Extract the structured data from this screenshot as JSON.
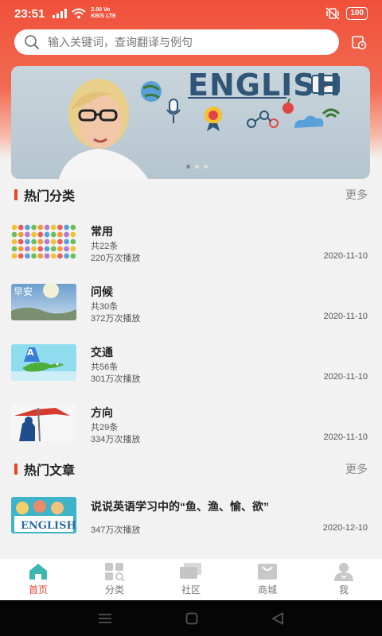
{
  "status_bar": {
    "time": "23:51",
    "net_speed_top": "2.00",
    "net_speed_unit": "KB/S",
    "net_type": "Vo",
    "net_lte": "LTE",
    "battery": "100"
  },
  "search": {
    "placeholder": "输入关键词，查询翻译与例句"
  },
  "banner": {
    "text": "ENGLISH",
    "pages": 3,
    "active_page": 0
  },
  "hot_categories": {
    "title": "热门分类",
    "more": "更多",
    "items": [
      {
        "title": "常用",
        "count": "共22条",
        "plays": "220万次播放",
        "date": "2020-11-10"
      },
      {
        "title": "问候",
        "count": "共30条",
        "plays": "372万次播放",
        "date": "2020-11-10"
      },
      {
        "title": "交通",
        "count": "共56条",
        "plays": "301万次播放",
        "date": "2020-11-10"
      },
      {
        "title": "方向",
        "count": "共29条",
        "plays": "334万次播放",
        "date": "2020-11-10"
      }
    ]
  },
  "hot_articles": {
    "title": "热门文章",
    "more": "更多",
    "items": [
      {
        "title": "说说英语学习中的“鱼、渔、愉、欲”",
        "plays": "347万次播放",
        "date": "2020-12-10",
        "thumb_text": "ENGLISH"
      }
    ]
  },
  "thumb_text": {
    "greeting": "早安"
  },
  "bottom_nav": [
    {
      "label": "首页",
      "icon": "home-icon",
      "active": true
    },
    {
      "label": "分类",
      "icon": "category-icon",
      "active": false
    },
    {
      "label": "社区",
      "icon": "community-icon",
      "active": false
    },
    {
      "label": "商城",
      "icon": "mall-icon",
      "active": false
    },
    {
      "label": "我",
      "icon": "profile-icon",
      "active": false
    }
  ],
  "colors": {
    "accent": "#e8452f",
    "header": "#f0503a",
    "background": "#f2f2f2"
  }
}
